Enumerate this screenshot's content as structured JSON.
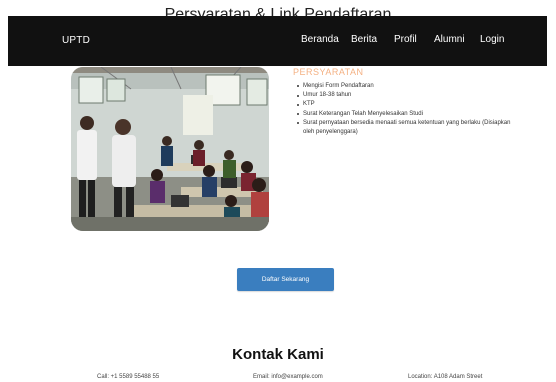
{
  "section": {
    "title": "Persyaratan & Link Pendaftaran"
  },
  "navbar": {
    "brand": "UPTD",
    "links": [
      "Beranda",
      "Berita",
      "Profil",
      "Alumni",
      "Login"
    ],
    "background": "#111111"
  },
  "requirements": {
    "title": "PERSYARATAN",
    "title_color": "#f4b183",
    "items": [
      "Mengisi Form Pendaftaran",
      "Umur 18-38 tahun",
      "KTP",
      "Surat Keterangan Telah Menyelesaikan Studi",
      "Surat pernyataan bersedia menaati semua ketentuan yang berlaku (Disiapkan oleh penyelenggara)"
    ]
  },
  "register": {
    "label": "Daftar Sekarang",
    "color": "#3a7ebf"
  },
  "contact": {
    "title": "Kontak Kami",
    "phone": "Call: +1 5589 55488 55",
    "email": "Email: info@example.com",
    "location": "Location: A108 Adam Street"
  }
}
